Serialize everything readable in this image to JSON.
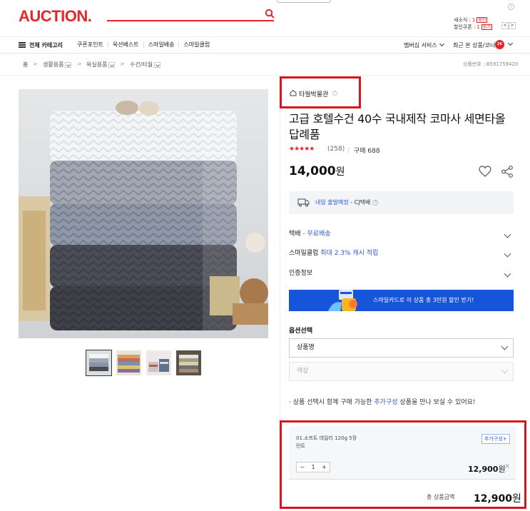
{
  "header": {
    "logo": "AUCTION.",
    "news_label": "새소식 :",
    "news_count": "1",
    "news_badge": "확인",
    "coupon_label": "할인쿠폰 :",
    "coupon_count": "1",
    "coupon_badge": "받기"
  },
  "nav": {
    "all_categories": "전체 카테고리",
    "links": [
      "쿠폰포인트",
      "옥션베스트",
      "스마일배송",
      "스마일클럽"
    ],
    "membership": "멤버십 서비스",
    "recent": "최근 본 상품/코너",
    "recent_badge": "26"
  },
  "breadcrumb": {
    "home": "홈",
    "items": [
      "생활용품",
      "욕실용품",
      "수건/타월"
    ],
    "product_no": "상품번호 : B591759420"
  },
  "product": {
    "store": "타월박물관",
    "title": "고급 호텔수건 40수 국내제작 코마사 세면타올 답례품",
    "rating": 4.5,
    "stars": "★★★★★",
    "review_count": "(258)",
    "purchase": "구매 688",
    "price": "14,000",
    "won": "원",
    "shipping_day": "내일 출발예정",
    "shipping_carrier": " - CJ택배"
  },
  "info_rows": [
    {
      "label": "택배",
      "value": " - 무료배송"
    },
    {
      "label": "스마일클럽",
      "value": " 최대 2.3% 캐시 적립"
    },
    {
      "label": "인증정보",
      "value": ""
    }
  ],
  "promo": {
    "text": "스마일카드로 이 상품 총 3만원 할인 받기!"
  },
  "options": {
    "label": "옵션선택",
    "select1": "상품명",
    "select2": "색상",
    "notice_prefix": "상품 선택시 함께 구매 가능한 ",
    "notice_link": "추가구성",
    "notice_suffix": " 상품을 만나 보실 수 있어요!"
  },
  "selected": {
    "name_line1": "01.소프트 데일리 120g 5장",
    "name_line2": "민트",
    "addon": "추가구성+",
    "qty": "1",
    "minus": "−",
    "plus": "+",
    "price": "12,900",
    "won": "원",
    "remove": "×",
    "total_label": "총 상품금액",
    "total": "12,900",
    "total_won": "원"
  },
  "colors": {
    "brand": "#e4262b",
    "link_blue": "#2c5bd6",
    "promo_blue": "#1655d9",
    "highlight_red": "#d8151c"
  }
}
